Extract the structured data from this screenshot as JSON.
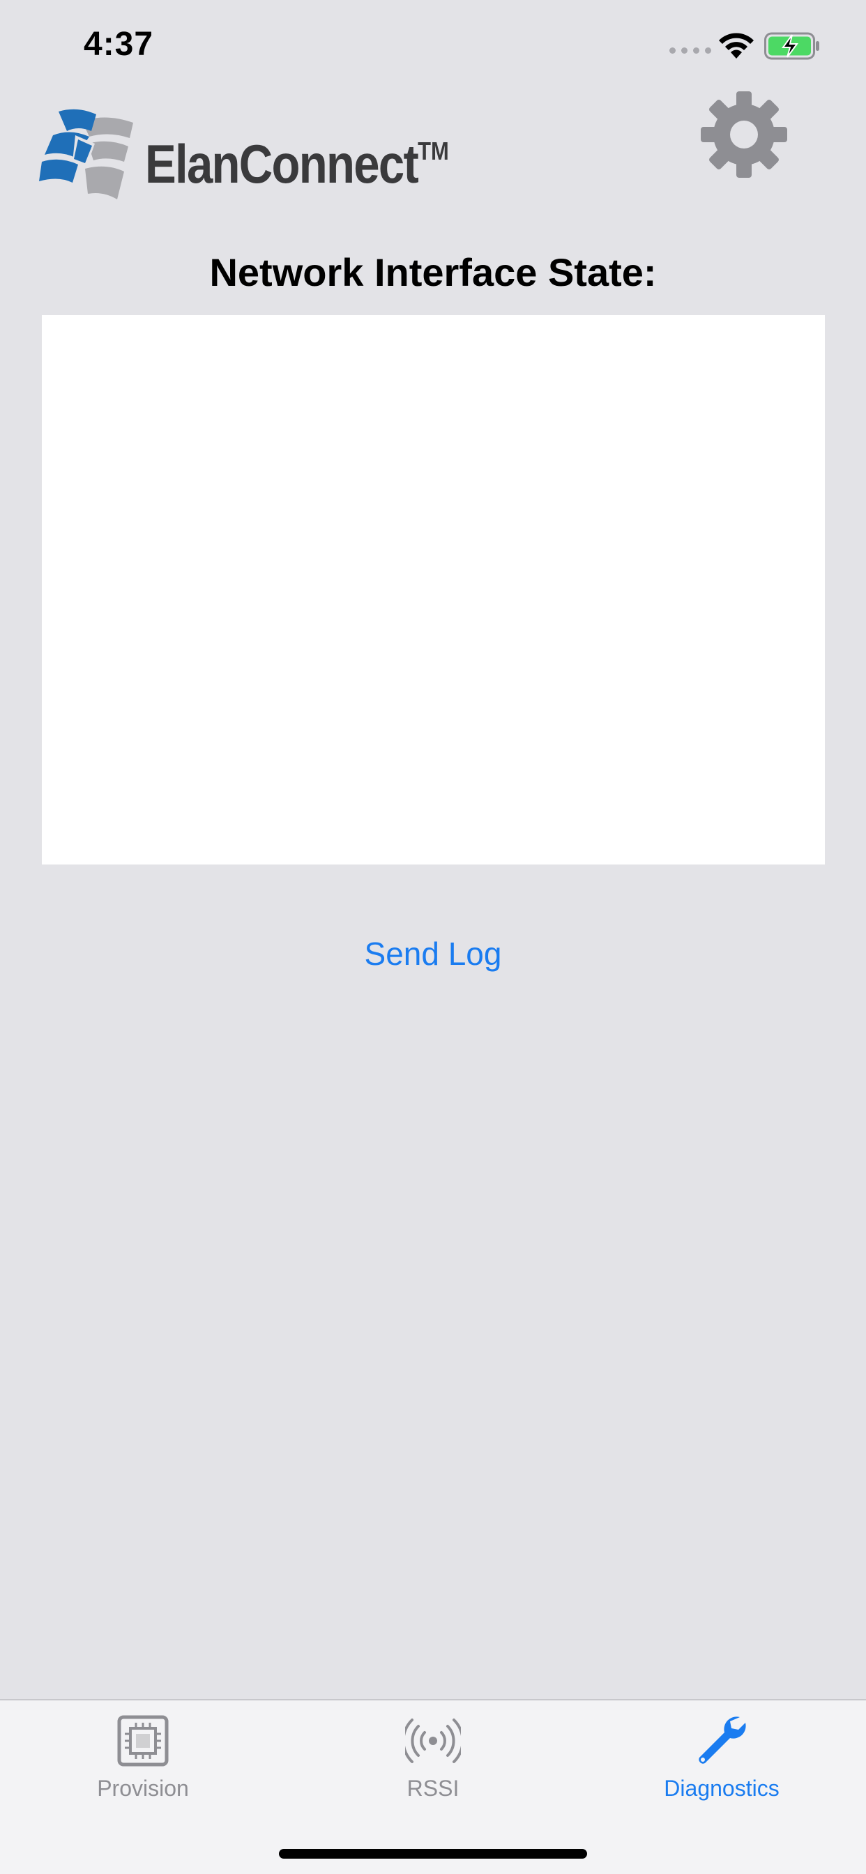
{
  "status_bar": {
    "time": "4:37"
  },
  "header": {
    "logo_text": "ElanConnect",
    "logo_trademark": "TM",
    "logo_icon": "elan-logo",
    "settings_icon": "gear-icon"
  },
  "main": {
    "section_title": "Network Interface State:",
    "log_content": "",
    "send_log_label": "Send Log"
  },
  "tab_bar": {
    "tabs": [
      {
        "label": "Provision",
        "icon": "chip-icon",
        "active": false
      },
      {
        "label": "RSSI",
        "icon": "signal-broadcast-icon",
        "active": false
      },
      {
        "label": "Diagnostics",
        "icon": "wrench-icon",
        "active": true
      }
    ]
  },
  "colors": {
    "background": "#e3e3e7",
    "accent": "#1a7cf0",
    "inactive": "#8e8e93",
    "logo_blue": "#1f6fb8",
    "logo_gray": "#a9a9ad"
  }
}
